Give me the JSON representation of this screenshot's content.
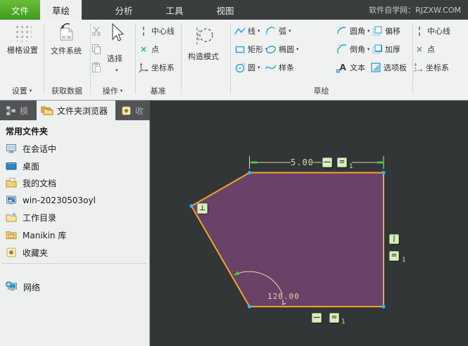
{
  "titlebar": {
    "tabs": [
      {
        "label": "文件"
      },
      {
        "label": "草绘"
      },
      {
        "label": "分析"
      },
      {
        "label": "工具"
      },
      {
        "label": "视图"
      }
    ],
    "site": "软件自学网：RJZXW.COM"
  },
  "ribbon": {
    "grid_settings": "栅格设置",
    "file_system": "文件系统",
    "select": "选择",
    "centerline": "中心线",
    "point": "点",
    "csys": "坐标系",
    "construction_mode": "构造模式",
    "line": "线",
    "rectangle": "矩形",
    "circle": "圆",
    "arc": "弧",
    "ellipse": "椭圆",
    "spline": "样条",
    "fillet": "圆角",
    "chamfer": "倒角",
    "text": "文本",
    "offset": "偏移",
    "thicken": "加厚",
    "palette": "选项板",
    "centerline2": "中心线",
    "point2": "点",
    "csys2": "坐标系",
    "groups": {
      "settings": "设置",
      "get_data": "获取数据",
      "operations": "操作",
      "datum": "基准",
      "sketch": "草绘"
    }
  },
  "glyphs": {
    "dropdown": "▾",
    "text_icon": "A"
  },
  "panel": {
    "tabs": [
      {
        "label": "模"
      },
      {
        "label": "文件夹浏览器"
      },
      {
        "label": "收"
      }
    ],
    "header": "常用文件夹",
    "items": [
      {
        "label": "在会话中",
        "icon": "monitor-session-icon"
      },
      {
        "label": "桌面",
        "icon": "desktop-icon"
      },
      {
        "label": "我的文档",
        "icon": "documents-folder-icon"
      },
      {
        "label": "win-20230503oyl",
        "icon": "computer-icon"
      },
      {
        "label": "工作目录",
        "icon": "working-directory-icon"
      },
      {
        "label": "Manikin 库",
        "icon": "library-folder-icon"
      },
      {
        "label": "收藏夹",
        "icon": "favorites-icon"
      }
    ],
    "network": "网络"
  },
  "canvas": {
    "width_dim": "5.00",
    "angle_dim": "120.00",
    "constraint_sub": "1",
    "symbols": {
      "horizontal": "—",
      "equal": "=",
      "vertical": "|",
      "perpendicular": "⊥"
    },
    "colors": {
      "background": "#323637",
      "polygon_fill": "#6b4267",
      "polygon_edge": "#f2a42b",
      "vertex": "#2fb4ea",
      "dimension": "#ded7a8",
      "constraint_bg": "#d8edc2",
      "tick_green": "#3ecc3e"
    }
  }
}
